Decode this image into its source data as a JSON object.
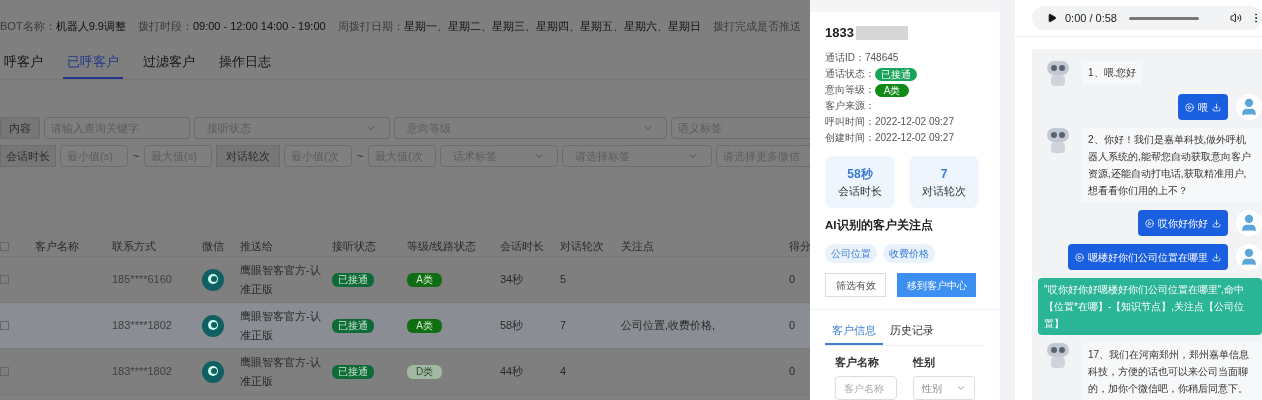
{
  "info_bar": [
    {
      "label": "BOT名称：",
      "value": "机器人9.9调整"
    },
    {
      "label": "拨打时段：",
      "value": "09:00 - 12:00 14:00 - 19:00"
    },
    {
      "label": "周拨打日期：",
      "value": "星期一、星期二、星期三、星期四、星期五、星期六、星期日"
    },
    {
      "label": "拨打完成是否推送"
    }
  ],
  "tabs": [
    {
      "label": "呼客户",
      "selected": false
    },
    {
      "label": "已呼客户",
      "selected": true
    },
    {
      "label": "过滤客户",
      "selected": false
    },
    {
      "label": "操作日志",
      "selected": false
    }
  ],
  "filters_row_1": [
    {
      "kind": "label",
      "text": "内容"
    },
    {
      "kind": "input",
      "placeholder": "请输入查询关键字"
    },
    {
      "kind": "select",
      "text": "接听状态"
    },
    {
      "kind": "select",
      "text": "意向等级"
    },
    {
      "kind": "input",
      "placeholder": "语义标签"
    }
  ],
  "filters_row_2": [
    {
      "kind": "label",
      "text": "会话时长"
    },
    {
      "kind": "input",
      "placeholder": "最小值(s)"
    },
    {
      "kind": "tilde",
      "text": "~"
    },
    {
      "kind": "input",
      "placeholder": "最大值(s)"
    },
    {
      "kind": "label",
      "text": "对话轮次"
    },
    {
      "kind": "input",
      "placeholder": "最小值(次"
    },
    {
      "kind": "tilde",
      "text": "~"
    },
    {
      "kind": "input",
      "placeholder": "最大值(次"
    },
    {
      "kind": "select",
      "text": "话术标签"
    },
    {
      "kind": "select",
      "text": "请选择标签"
    },
    {
      "kind": "input",
      "placeholder": "请选择更多微信"
    }
  ],
  "table": {
    "all_checked": false,
    "columns": [
      "客户名称",
      "联系方式",
      "微信",
      "推送给",
      "接听状态",
      "等级/线路状态",
      "会话时长",
      "对话轮次",
      "关注点",
      "得分"
    ],
    "rows": [
      {
        "checked": false,
        "selected": false,
        "phone": "185****6160",
        "push_to": "鹰眼智客官方-认准正版",
        "status": "已接通",
        "level": "A类",
        "level_faded": false,
        "duration": "34秒",
        "turns": "5",
        "score": "0"
      },
      {
        "checked": false,
        "selected": true,
        "phone": "183****1802",
        "push_to": "鹰眼智客官方-认准正版",
        "status": "已接通",
        "level": "A类",
        "level_faded": false,
        "duration": "58秒",
        "turns": "7",
        "focus": "公司位置,收费价格,",
        "score": "0"
      },
      {
        "checked": false,
        "selected": false,
        "phone": "183****1802",
        "push_to": "鹰眼智客官方-认准正版",
        "status": "已接通",
        "level": "D类",
        "level_faded": true,
        "duration": "44秒",
        "turns": "4",
        "score": "0"
      }
    ]
  },
  "detail": {
    "phone": "1833",
    "fields": [
      {
        "label": "通话ID：",
        "value": "748645"
      },
      {
        "label": "通话状态：",
        "badge": "已接通",
        "color": "#1aa35a"
      },
      {
        "label": "意向等级：",
        "badge": "A类",
        "color": "#0f8a16"
      },
      {
        "label": "客户来源："
      },
      {
        "label": "呼叫时间：",
        "value": "2022-12-02 09:27"
      },
      {
        "label": "创建时间：",
        "value": "2022-12-02 09:27"
      }
    ],
    "stats": [
      {
        "value": "58秒",
        "label": "会话时长"
      },
      {
        "value": "7",
        "label": "对话轮次"
      }
    ],
    "focus_title": "AI识别的客户关注点",
    "focus_tags": [
      "公司位置",
      "收费价格"
    ],
    "buttons": [
      {
        "label": "筛选有效",
        "kind": "outline"
      },
      {
        "label": "移到客户中心",
        "kind": "primary"
      }
    ],
    "tabs": [
      {
        "label": "客户信息",
        "selected": true
      },
      {
        "label": "历史记录",
        "selected": false
      }
    ],
    "form": [
      {
        "label": "客户名称",
        "placeholder": "客户名称",
        "kind": "input"
      },
      {
        "label": "性别",
        "text": "性别",
        "kind": "select"
      }
    ]
  },
  "player": {
    "time": "0:00 / 0:58"
  },
  "chat": [
    {
      "kind": "robot",
      "text": "1、喂.您好"
    },
    {
      "kind": "user",
      "text": "喂"
    },
    {
      "kind": "robot",
      "text": "2、你好！我们是嘉单科技,做外呼机器人系统的,能帮您自动获取意向客户资源,还能自动打电话,获取精准用户,想看看你们用的上不？"
    },
    {
      "kind": "user",
      "text": "哎你好你好"
    },
    {
      "kind": "user",
      "text": "嗯楼好你们公司位置在哪里"
    },
    {
      "kind": "hit",
      "text": "\"哎你好你好嗯楼好你们公司位置在哪里\",命中【位置*在哪】-【知识节点】,关注点【公司位置】"
    },
    {
      "kind": "robot",
      "text": "17、我们在河南郑州，郑州嘉单信息科技，方便的话也可以来公司当面聊的，加你个微信吧，你稍后同意下。"
    }
  ]
}
